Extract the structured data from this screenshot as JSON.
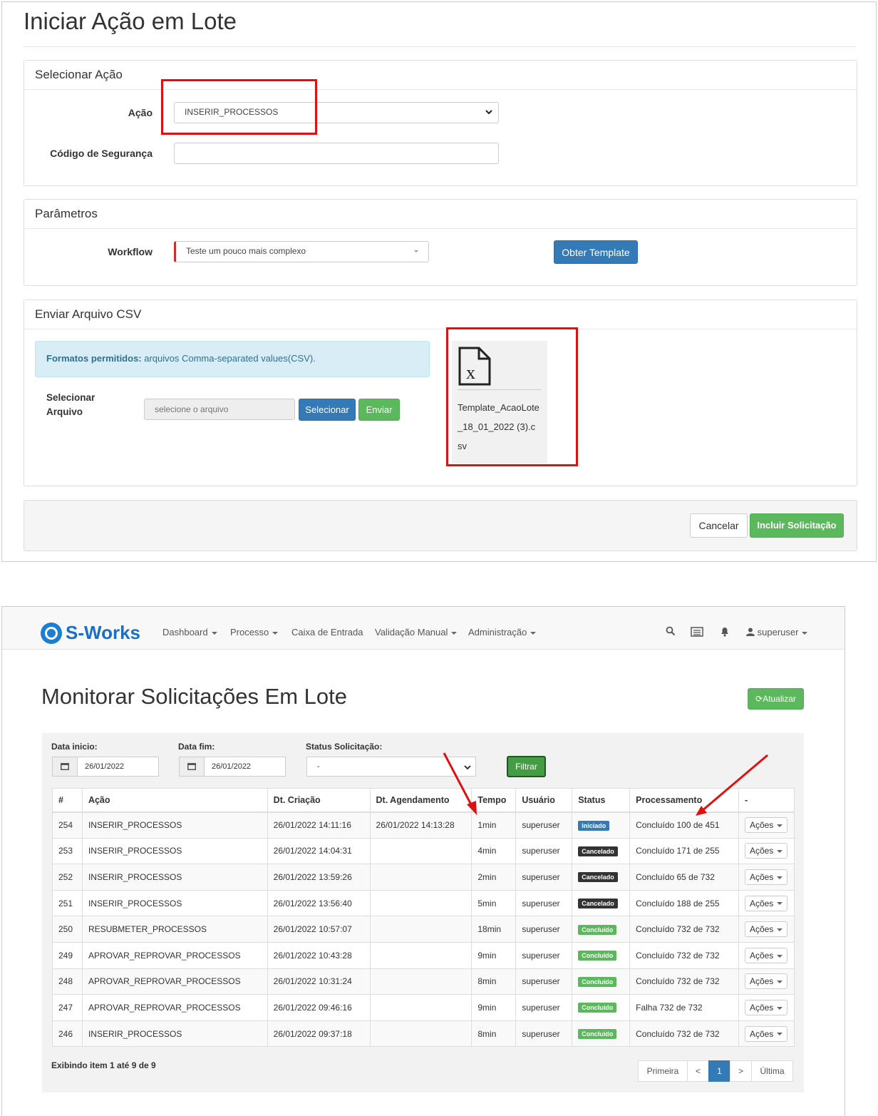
{
  "form": {
    "title": "Iniciar Ação em Lote",
    "select_panel": {
      "heading": "Selecionar Ação",
      "acao_label": "Ação",
      "acao_value": "INSERIR_PROCESSOS",
      "codigo_label": "Código de Segurança",
      "codigo_value": ""
    },
    "params_panel": {
      "heading": "Parâmetros",
      "workflow_label": "Workflow",
      "workflow_value": "Teste um pouco mais complexo",
      "template_button": "Obter Template"
    },
    "csv_panel": {
      "heading": "Enviar Arquivo CSV",
      "alert_strong": "Formatos permitidos:",
      "alert_text": " arquivos Comma-separated values(CSV).",
      "file_label_1": "Selecionar",
      "file_label_2": "Arquivo",
      "file_placeholder": "selecione o arquivo",
      "select_button": "Selecionar",
      "send_button": "Enviar",
      "file_name_1": "Template_AcaoLote",
      "file_name_2": "_18_01_2022 (3).c",
      "file_name_3": "sv"
    },
    "footer": {
      "cancel_button": "Cancelar",
      "submit_button": "Incluir Solicitação"
    }
  },
  "monitor": {
    "brand": "S-Works",
    "nav": {
      "dashboard": "Dashboard",
      "processo": "Processo",
      "caixa": "Caixa de Entrada",
      "validacao": "Validação Manual",
      "admin": "Administração",
      "user": "superuser"
    },
    "title": "Monitorar Solicitações Em Lote",
    "refresh_button": "Atualizar",
    "filters": {
      "data_inicio_label": "Data inicio:",
      "data_inicio_value": "26/01/2022",
      "data_fim_label": "Data fim:",
      "data_fim_value": "26/01/2022",
      "status_label": "Status Solicitação:",
      "status_value": "-",
      "filter_button": "Filtrar"
    },
    "columns": [
      "#",
      "Ação",
      "Dt. Criação",
      "Dt. Agendamento",
      "Tempo",
      "Usuário",
      "Status",
      "Processamento",
      "-"
    ],
    "actions_label": "Ações",
    "rows": [
      {
        "id": "254",
        "acao": "INSERIR_PROCESSOS",
        "criacao": "26/01/2022 14:11:16",
        "agendamento": "26/01/2022 14:13:28",
        "tempo": "1min",
        "usuario": "superuser",
        "status": "Iniciado",
        "processamento": "Concluído 100 de 451"
      },
      {
        "id": "253",
        "acao": "INSERIR_PROCESSOS",
        "criacao": "26/01/2022 14:04:31",
        "agendamento": "",
        "tempo": "4min",
        "usuario": "superuser",
        "status": "Cancelado",
        "processamento": "Concluído 171 de 255"
      },
      {
        "id": "252",
        "acao": "INSERIR_PROCESSOS",
        "criacao": "26/01/2022 13:59:26",
        "agendamento": "",
        "tempo": "2min",
        "usuario": "superuser",
        "status": "Cancelado",
        "processamento": "Concluído 65 de 732"
      },
      {
        "id": "251",
        "acao": "INSERIR_PROCESSOS",
        "criacao": "26/01/2022 13:56:40",
        "agendamento": "",
        "tempo": "5min",
        "usuario": "superuser",
        "status": "Cancelado",
        "processamento": "Concluído 188 de 255"
      },
      {
        "id": "250",
        "acao": "RESUBMETER_PROCESSOS",
        "criacao": "26/01/2022 10:57:07",
        "agendamento": "",
        "tempo": "18min",
        "usuario": "superuser",
        "status": "Concluído",
        "processamento": "Concluído 732 de 732"
      },
      {
        "id": "249",
        "acao": "APROVAR_REPROVAR_PROCESSOS",
        "criacao": "26/01/2022 10:43:28",
        "agendamento": "",
        "tempo": "9min",
        "usuario": "superuser",
        "status": "Concluído",
        "processamento": "Concluído 732 de 732"
      },
      {
        "id": "248",
        "acao": "APROVAR_REPROVAR_PROCESSOS",
        "criacao": "26/01/2022 10:31:24",
        "agendamento": "",
        "tempo": "8min",
        "usuario": "superuser",
        "status": "Concluído",
        "processamento": "Concluído 732 de 732"
      },
      {
        "id": "247",
        "acao": "APROVAR_REPROVAR_PROCESSOS",
        "criacao": "26/01/2022 09:46:16",
        "agendamento": "",
        "tempo": "9min",
        "usuario": "superuser",
        "status": "Concluído",
        "processamento": "Falha 732 de 732"
      },
      {
        "id": "246",
        "acao": "INSERIR_PROCESSOS",
        "criacao": "26/01/2022 09:37:18",
        "agendamento": "",
        "tempo": "8min",
        "usuario": "superuser",
        "status": "Concluído",
        "processamento": "Concluído 732 de 732"
      }
    ],
    "status_colors": {
      "Iniciado": "#337ab7",
      "Cancelado": "#333333",
      "Concluído": "#5cb85c"
    },
    "summary": "Exibindo item 1 até 9 de 9",
    "pagination": {
      "first": "Primeira",
      "prev": "<",
      "current": "1",
      "next": ">",
      "last": "Última"
    }
  }
}
